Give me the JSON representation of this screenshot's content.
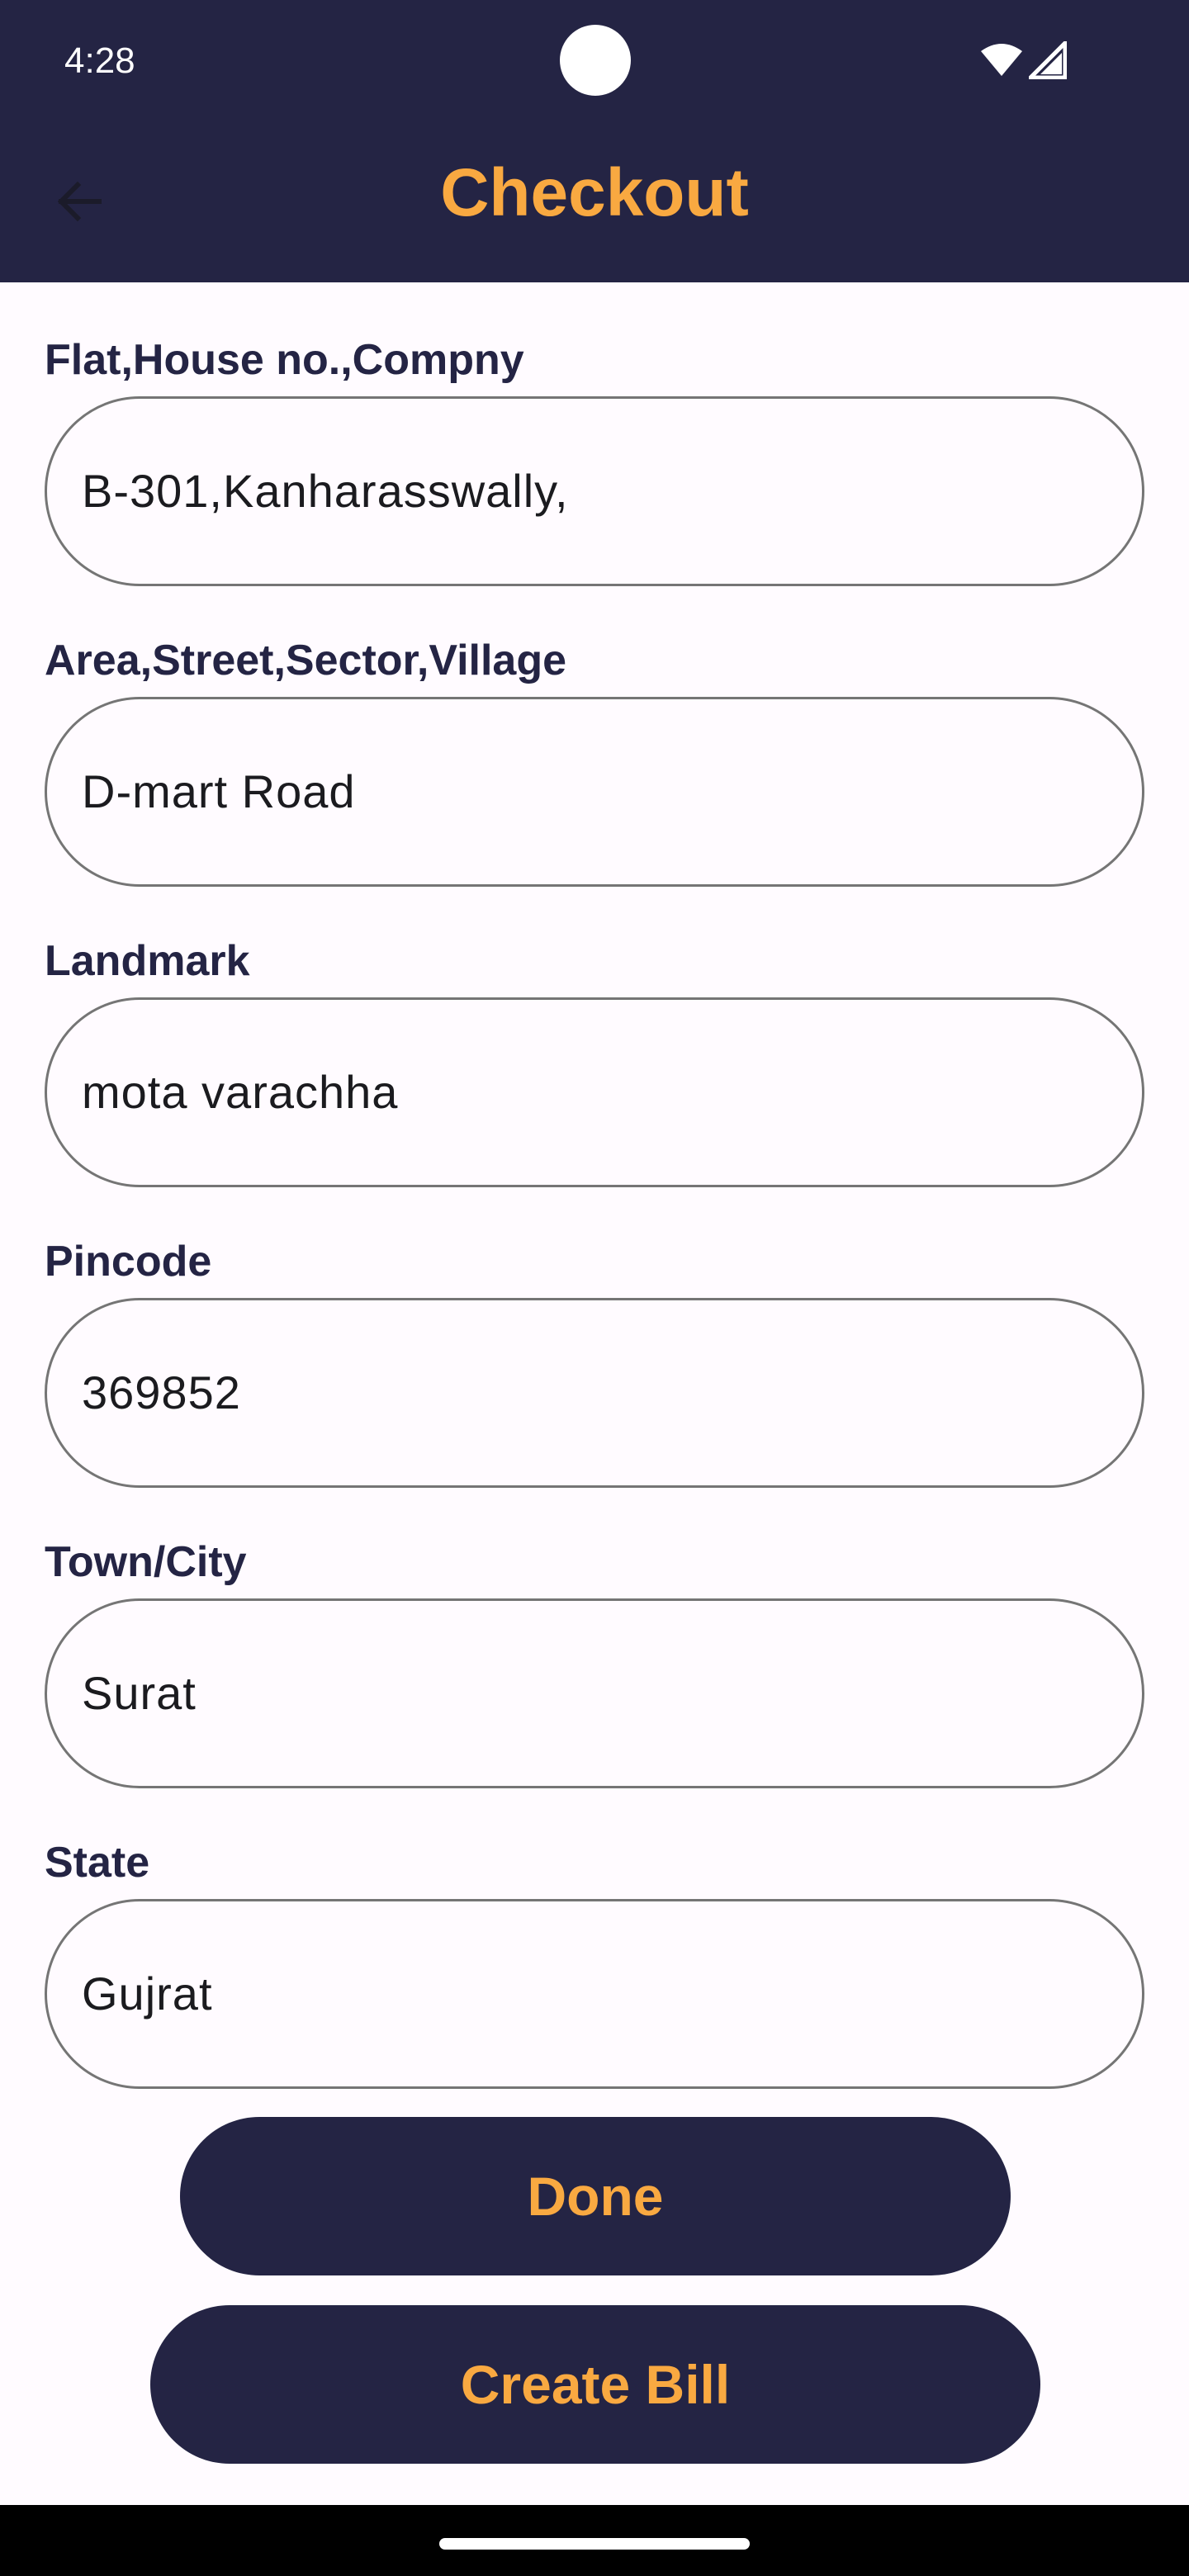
{
  "status_bar": {
    "time": "4:28",
    "icons": [
      "camera-cutout",
      "wifi-icon",
      "cell-signal-icon"
    ]
  },
  "header": {
    "title": "Checkout",
    "back_icon": "arrow-left-icon"
  },
  "form": {
    "fields": [
      {
        "label": "Flat,House no.,Compny",
        "value": "B-301,Kanharasswally,"
      },
      {
        "label": "Area,Street,Sector,Village",
        "value": "D-mart Road"
      },
      {
        "label": "Landmark",
        "value": "mota varachha"
      },
      {
        "label": "Pincode",
        "value": "369852"
      },
      {
        "label": "Town/City",
        "value": "Surat"
      },
      {
        "label": "State",
        "value": "Gujrat"
      }
    ]
  },
  "actions": {
    "done_label": "Done",
    "create_bill_label": "Create Bill"
  },
  "colors": {
    "header_bg": "#242444",
    "accent": "#f9a941",
    "background": "#fffbff",
    "field_border": "#757575"
  }
}
